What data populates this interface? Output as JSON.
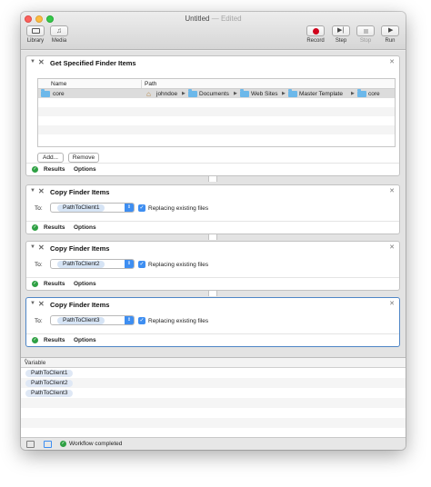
{
  "window": {
    "title": "Untitled",
    "title_suffix": "— Edited"
  },
  "toolbar": {
    "left": [
      {
        "label": "Library",
        "icon": "library-icon"
      },
      {
        "label": "Media",
        "icon": "media-icon"
      }
    ],
    "right": [
      {
        "label": "Record",
        "icon": "record-icon",
        "enabled": true
      },
      {
        "label": "Step",
        "icon": "step-icon",
        "enabled": true
      },
      {
        "label": "Stop",
        "icon": "stop-icon",
        "enabled": false
      },
      {
        "label": "Run",
        "icon": "run-icon",
        "enabled": true
      }
    ]
  },
  "actions": {
    "get_items": {
      "title": "Get Specified Finder Items",
      "columns": [
        "Name",
        "Path"
      ],
      "rows": [
        {
          "name": "core",
          "path": [
            "johndoe",
            "Documents",
            "Web Sites",
            "Master Template",
            "core"
          ]
        }
      ],
      "add_label": "Add...",
      "remove_label": "Remove",
      "results_label": "Results",
      "options_label": "Options"
    },
    "copy1": {
      "title": "Copy Finder Items",
      "to_label": "To:",
      "destination": "PathToClient1",
      "replace_label": "Replacing existing files",
      "replace_checked": true,
      "results_label": "Results",
      "options_label": "Options"
    },
    "copy2": {
      "title": "Copy Finder Items",
      "to_label": "To:",
      "destination": "PathToClient2",
      "replace_label": "Replacing existing files",
      "replace_checked": true,
      "results_label": "Results",
      "options_label": "Options"
    },
    "copy3": {
      "title": "Copy Finder Items",
      "to_label": "To:",
      "destination": "PathToClient3",
      "replace_label": "Replacing existing files",
      "replace_checked": true,
      "results_label": "Results",
      "options_label": "Options"
    }
  },
  "variables": {
    "header": "Variable",
    "items": [
      "PathToClient1",
      "PathToClient2",
      "PathToClient3"
    ]
  },
  "status": {
    "text": "Workflow completed"
  },
  "colors": {
    "accent": "#3e8ef1",
    "success": "#2ea043",
    "record": "#d0021b",
    "folder": "#6cb8ea"
  }
}
